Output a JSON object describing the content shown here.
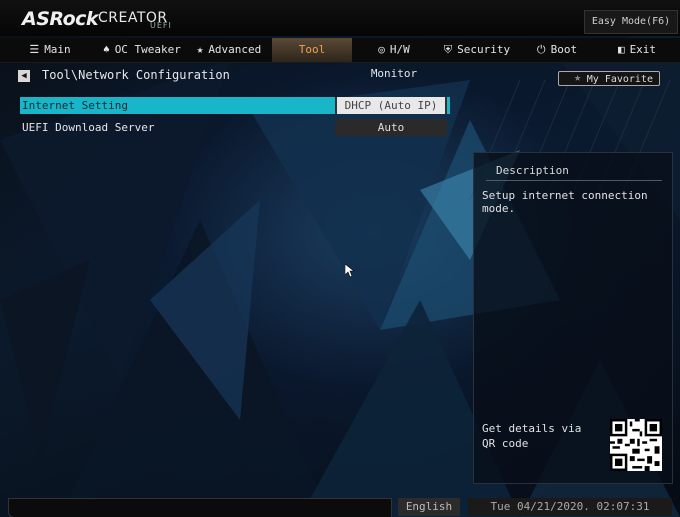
{
  "header": {
    "brand": "ASRock",
    "brand_sub": "CREATOR",
    "brand_uefi": "UEFI",
    "easy_mode": "Easy Mode(F6)"
  },
  "nav": {
    "items": [
      {
        "label": "Main",
        "icon": "list-icon",
        "glyph": "☰"
      },
      {
        "label": "OC Tweaker",
        "icon": "rocket-icon",
        "glyph": "♠"
      },
      {
        "label": "Advanced",
        "icon": "star-icon",
        "glyph": "★"
      },
      {
        "label": "Tool",
        "icon": "",
        "glyph": ""
      },
      {
        "label": "H/W Monitor",
        "icon": "monitor-icon",
        "glyph": "◎"
      },
      {
        "label": "Security",
        "icon": "shield-icon",
        "glyph": "⛨"
      },
      {
        "label": "Boot",
        "icon": "power-icon",
        "glyph": "⏻"
      },
      {
        "label": "Exit",
        "icon": "exit-icon",
        "glyph": "◧"
      }
    ],
    "active": "Tool"
  },
  "breadcrumb": "Tool\\Network Configuration",
  "favorite": "My Favorite",
  "settings": [
    {
      "label": "Internet Setting",
      "value": "DHCP (Auto IP)",
      "selected": true
    },
    {
      "label": "UEFI Download Server",
      "value": "Auto",
      "selected": false
    }
  ],
  "description": {
    "title": "Description",
    "text": "Setup internet connection mode.",
    "qr_text": "Get details via QR code"
  },
  "footer": {
    "language": "English",
    "datetime": "Tue 04/21/2020. 02:07:31"
  },
  "colors": {
    "accent": "#19b6c9",
    "tab_active_text": "#f0a15a"
  }
}
